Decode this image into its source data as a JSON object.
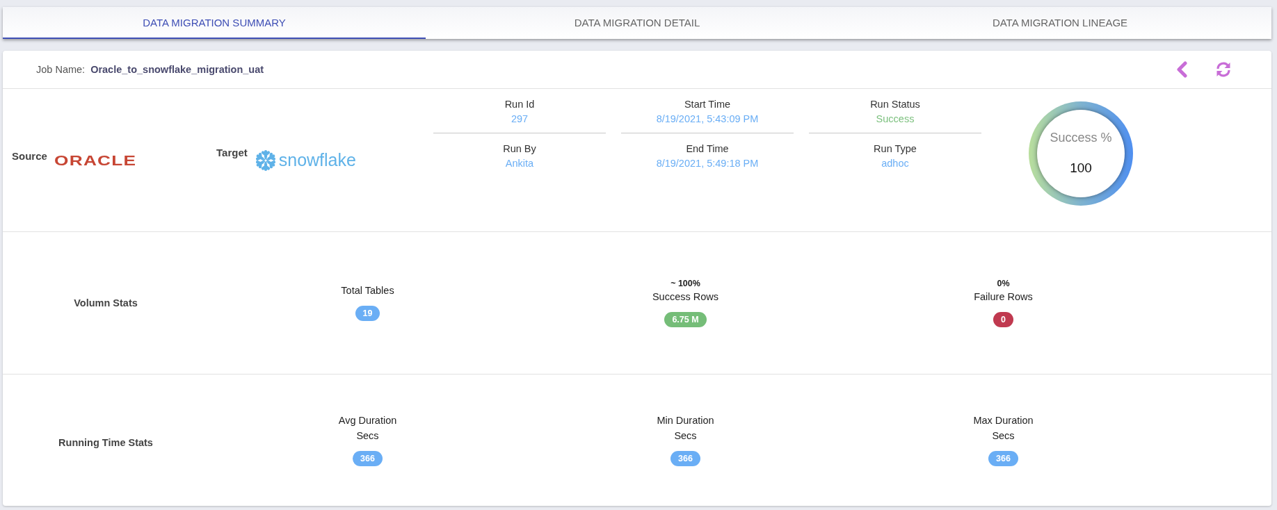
{
  "tabs": [
    {
      "label": "DATA MIGRATION SUMMARY",
      "selected": true
    },
    {
      "label": "DATA MIGRATION DETAIL",
      "selected": false
    },
    {
      "label": "DATA MIGRATION LINEAGE",
      "selected": false
    }
  ],
  "job": {
    "label": "Job Name:",
    "name": "Oracle_to_snowflake_migration_uat"
  },
  "source": {
    "label": "Source",
    "logo_text": "ORACLE"
  },
  "target": {
    "label": "Target",
    "logo_text": "snowflake"
  },
  "run_fields": [
    {
      "label": "Run Id",
      "value": "297",
      "color": "#6aaef5"
    },
    {
      "label": "Start Time",
      "value": "8/19/2021, 5:43:09 PM",
      "color": "#6aaef5"
    },
    {
      "label": "Run Status",
      "value": "Success",
      "color": "#7cc07e"
    },
    {
      "label": "Run By",
      "value": "Ankita",
      "color": "#6aaef5"
    },
    {
      "label": "End Time",
      "value": "8/19/2021, 5:49:18 PM",
      "color": "#6aaef5"
    },
    {
      "label": "Run Type",
      "value": "adhoc",
      "color": "#6aaef5"
    }
  ],
  "success_gauge": {
    "label": "Success %",
    "value": "100"
  },
  "volume_stats": {
    "title": "Volumn Stats",
    "items": [
      {
        "label": "Total Tables",
        "badge": "19",
        "color": "#6aaef5"
      },
      {
        "note": "~ 100%",
        "label": "Success Rows",
        "badge": "6.75 M",
        "color": "#75bd78"
      },
      {
        "note": "0%",
        "label": "Failure Rows",
        "badge": "0",
        "color": "#c0394f"
      }
    ]
  },
  "running_time_stats": {
    "title": "Running Time Stats",
    "items": [
      {
        "label": "Avg Duration",
        "unit": "Secs",
        "badge": "366",
        "color": "#6aaef5"
      },
      {
        "label": "Min Duration",
        "unit": "Secs",
        "badge": "366",
        "color": "#6aaef5"
      },
      {
        "label": "Max Duration",
        "unit": "Secs",
        "badge": "366",
        "color": "#6aaef5"
      }
    ]
  }
}
